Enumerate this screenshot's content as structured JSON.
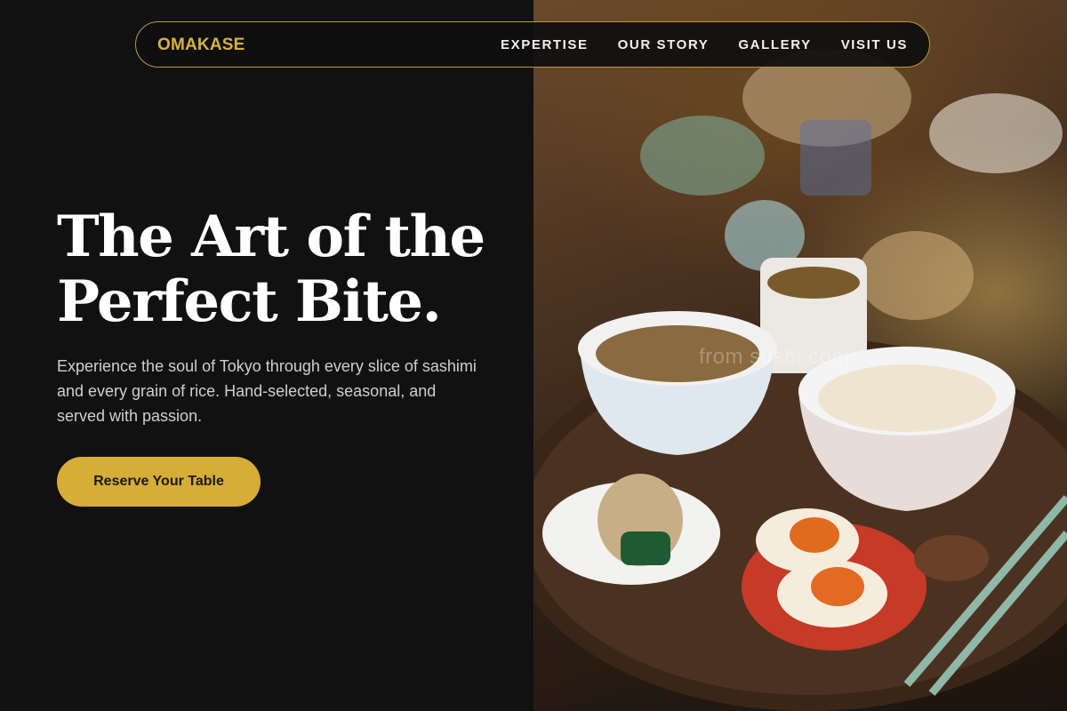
{
  "nav": {
    "brand": "OMAKASE",
    "links": [
      "EXPERTISE",
      "OUR STORY",
      "GALLERY",
      "VISIT US"
    ]
  },
  "hero": {
    "title_line1": "The Art of the",
    "title_line2": "Perfect Bite.",
    "subtitle": "Experience the soul of Tokyo through every slice of sashimi and every grain of rice. Hand-selected, seasonal, and served with passion.",
    "cta_label": "Reserve Your Table"
  },
  "photo": {
    "watermark": "from sushi.com"
  },
  "colors": {
    "background": "#111111",
    "accent": "#d6ad37",
    "nav_border": "#b8993d"
  }
}
